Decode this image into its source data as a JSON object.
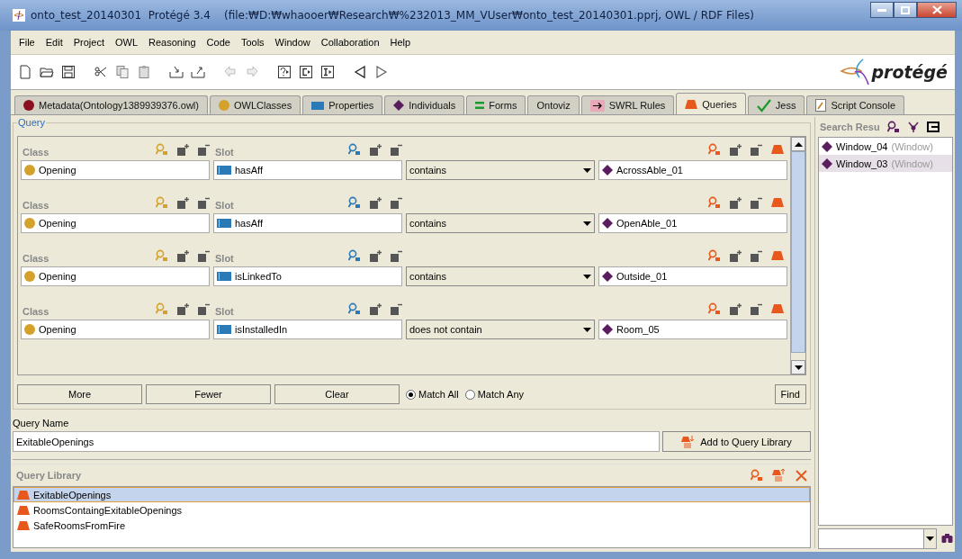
{
  "window": {
    "title": "onto_test_20140301  Protégé 3.4    (file:₩D:₩whaooer₩Research₩%232013_MM_VUser₩onto_test_20140301.pprj, OWL / RDF Files)"
  },
  "menu": [
    "File",
    "Edit",
    "Project",
    "OWL",
    "Reasoning",
    "Code",
    "Tools",
    "Window",
    "Collaboration",
    "Help"
  ],
  "logo": {
    "text": "protégé"
  },
  "tabs": [
    {
      "label": "Metadata(Ontology1389939376.owl)",
      "kind": "metadata",
      "selected": false
    },
    {
      "label": "OWLClasses",
      "kind": "classes",
      "selected": false
    },
    {
      "label": "Properties",
      "kind": "properties",
      "selected": false
    },
    {
      "label": "Individuals",
      "kind": "individuals",
      "selected": false
    },
    {
      "label": "Forms",
      "kind": "forms",
      "selected": false
    },
    {
      "label": "Ontoviz",
      "kind": "plain",
      "selected": false
    },
    {
      "label": "SWRL Rules",
      "kind": "swrl",
      "selected": false
    },
    {
      "label": "Queries",
      "kind": "queries",
      "selected": true
    },
    {
      "label": "Jess",
      "kind": "jess",
      "selected": false
    },
    {
      "label": "Script Console",
      "kind": "script",
      "selected": false
    }
  ],
  "query": {
    "title": "Query",
    "rows": [
      {
        "class_label": "Class",
        "class": "Opening",
        "slot_label": "Slot",
        "slot": "hasAff",
        "operator": "contains",
        "value": "AcrossAble_01"
      },
      {
        "class_label": "Class",
        "class": "Opening",
        "slot_label": "Slot",
        "slot": "hasAff",
        "operator": "contains",
        "value": "OpenAble_01"
      },
      {
        "class_label": "Class",
        "class": "Opening",
        "slot_label": "Slot",
        "slot": "isLinkedTo",
        "operator": "contains",
        "value": "Outside_01"
      },
      {
        "class_label": "Class",
        "class": "Opening",
        "slot_label": "Slot",
        "slot": "isInstalledIn",
        "operator": "does not contain",
        "value": "Room_05"
      }
    ],
    "buttons": [
      "More",
      "Fewer",
      "Clear"
    ],
    "match": [
      {
        "label": "Match All",
        "selected": true
      },
      {
        "label": "Match Any",
        "selected": false
      }
    ],
    "find": "Find"
  },
  "query_name": {
    "label": "Query Name",
    "value": "ExitableOpenings",
    "add_button": "Add to Query Library"
  },
  "query_library": {
    "title": "Query Library",
    "items": [
      {
        "name": "ExitableOpenings",
        "selected": true
      },
      {
        "name": "RoomsContaingExitableOpenings",
        "selected": false
      },
      {
        "name": "SafeRoomsFromFire",
        "selected": false
      }
    ]
  },
  "search_results": {
    "title": "Search Resu",
    "items": [
      {
        "name": "Window_04",
        "type": "(Window)",
        "selected": false
      },
      {
        "name": "Window_03",
        "type": "(Window)",
        "selected": true
      }
    ]
  }
}
